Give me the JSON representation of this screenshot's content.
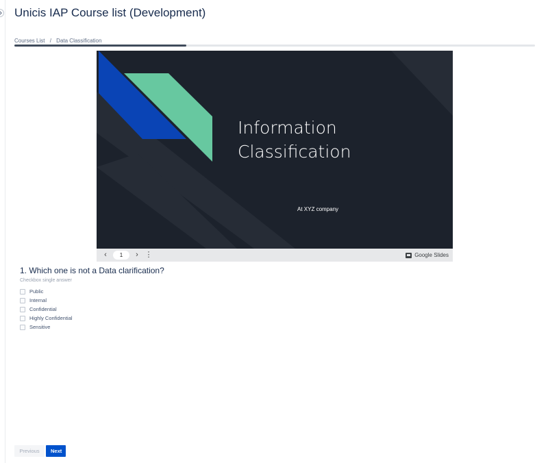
{
  "header": {
    "title": "Unicis IAP Course list (Development)"
  },
  "breadcrumb": {
    "items": [
      "Courses List",
      "Data Classification"
    ],
    "separator": "/"
  },
  "progress": {
    "fraction": 0.33
  },
  "slide": {
    "title_line1": "Information",
    "title_line2": "Classification",
    "subtitle": "At XYZ company",
    "colors": {
      "background": "#1c222c",
      "stripe": "#262c36",
      "blue": "#0a44b5",
      "green": "#67c8a0"
    }
  },
  "slides_viewer": {
    "current_page": "1",
    "brand": "Google Slides",
    "prev_icon": "chevron-left-icon",
    "next_icon": "chevron-right-icon",
    "menu_icon": "more-vertical-icon"
  },
  "question": {
    "title": "1. Which one is not a Data clarification?",
    "hint": "Checkbox single answer",
    "options": [
      "Public",
      "Internal",
      "Confidential",
      "Highly Confidential",
      "Sensitive"
    ]
  },
  "footer": {
    "previous_label": "Previous",
    "next_label": "Next",
    "accent": "#0052cc"
  }
}
